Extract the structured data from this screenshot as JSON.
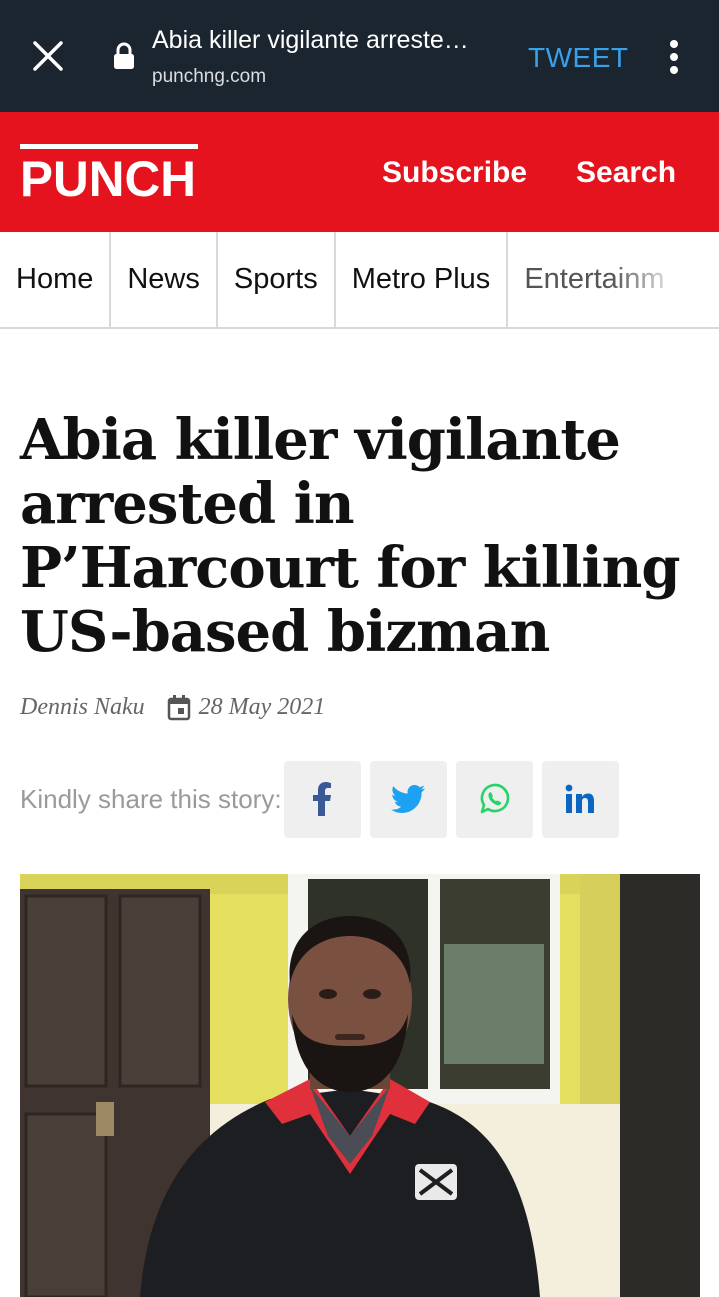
{
  "browser": {
    "tab_title": "Abia killer vigilante arreste…",
    "domain": "punchng.com",
    "tweet_label": "TWEET"
  },
  "header": {
    "logo_text": "PUNCH",
    "subscribe_label": "Subscribe",
    "search_label": "Search",
    "brand_color": "#e5131d"
  },
  "nav": {
    "items": [
      "Home",
      "News",
      "Sports",
      "Metro Plus",
      "Entertainm"
    ]
  },
  "article": {
    "headline": "Abia killer vigilante arrested in P’Harcourt for killing US-based bizman",
    "author": "Dennis Naku",
    "date": "28 May 2021"
  },
  "share": {
    "label": "Kindly share this story:",
    "buttons": [
      "facebook-icon",
      "twitter-icon",
      "whatsapp-icon",
      "linkedin-icon"
    ]
  }
}
